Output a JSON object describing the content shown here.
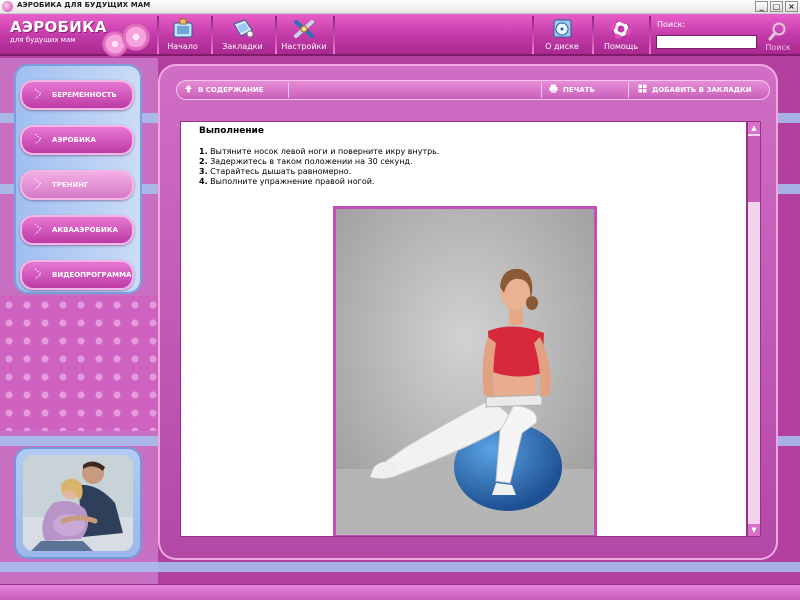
{
  "window": {
    "title": "АЭРОБИКА ДЛЯ БУДУЩИХ МАМ",
    "minimize": "_",
    "maximize": "□",
    "close": "×"
  },
  "logo": {
    "title": "АЭРОБИКА",
    "subtitle": "для будущих мам"
  },
  "nav": {
    "home": "Начало",
    "bookmarks": "Закладки",
    "settings": "Настройки",
    "about": "О диске",
    "help": "Помощь"
  },
  "search": {
    "label": "Поиск:",
    "value": "",
    "button": "Поиск"
  },
  "sidebar": {
    "items": [
      {
        "label": "БЕРЕМЕННОСТЬ"
      },
      {
        "label": "АЭРОБИКА"
      },
      {
        "label": "ТРЕНИНГ"
      },
      {
        "label": "АКВААЭРОБИКА"
      },
      {
        "label": "ВИДЕОПРОГРАММА"
      }
    ]
  },
  "toolbar": {
    "contents": "В СОДЕРЖАНИЕ",
    "print": "ПЕЧАТЬ",
    "bookmark": "ДОБАВИТЬ В ЗАКЛАДКИ"
  },
  "content": {
    "heading": "Выполнение",
    "steps": [
      {
        "num": "1.",
        "text": " Вытяните носок левой ноги и поверните икру внутрь."
      },
      {
        "num": "2.",
        "text": " Задержитесь в таком положении на 30 секунд."
      },
      {
        "num": "3.",
        "text": " Старайтесь дышать равномерно."
      },
      {
        "num": "4.",
        "text": " Выполните упражнение правой ногой."
      }
    ]
  },
  "colors": {
    "accent": "#c23aa8",
    "sidebar_blue": "#a5c4ee",
    "text": "#000000"
  }
}
